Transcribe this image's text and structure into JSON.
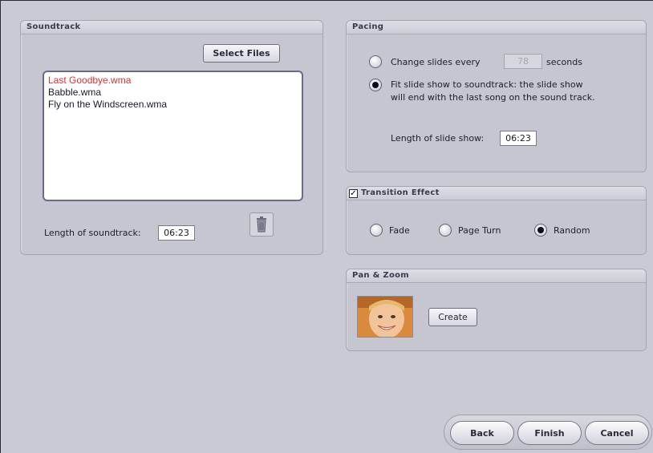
{
  "soundtrack": {
    "title": "Soundtrack",
    "select_files_label": "Select Files",
    "files": [
      "Last Goodbye.wma",
      "Babble.wma",
      "Fly on the Windscreen.wma"
    ],
    "length_label": "Length of soundtrack:",
    "length_value": "06:23",
    "delete_icon": "trash-icon"
  },
  "pacing": {
    "title": "Pacing",
    "option1_prefix": "Change slides every",
    "option1_value": "78",
    "option1_suffix": "seconds",
    "option2_line1": "Fit slide show to soundtrack: the slide show",
    "option2_line2": "will end with the last song on the sound track.",
    "selected_option": 2,
    "length_label": "Length of slide show:",
    "length_value": "06:23"
  },
  "transition": {
    "title": "Transition Effect",
    "enabled": true,
    "options": [
      "Fade",
      "Page Turn",
      "Random"
    ],
    "selected": "Random"
  },
  "pan_zoom": {
    "title": "Pan & Zoom",
    "create_label": "Create"
  },
  "footer": {
    "back_label": "Back",
    "finish_label": "Finish",
    "cancel_label": "Cancel"
  },
  "colors": {
    "selected_file": "#e03030",
    "background": "#c9c9d3"
  }
}
